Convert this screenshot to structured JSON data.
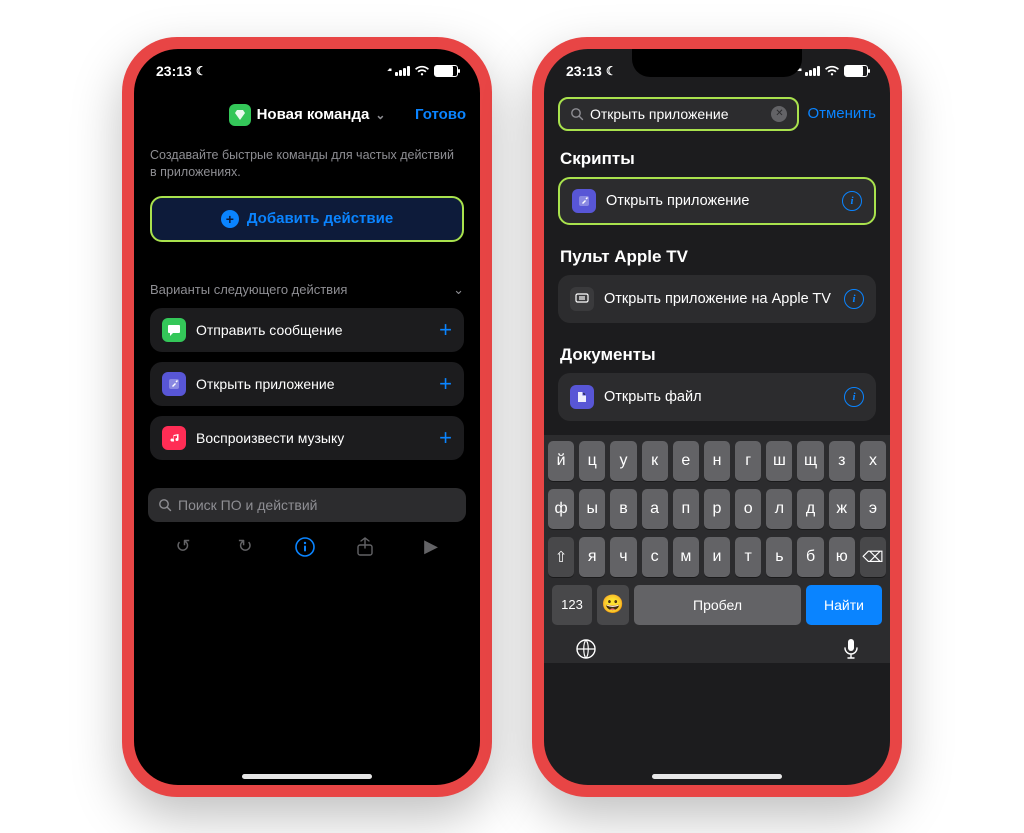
{
  "status": {
    "time": "23:13"
  },
  "phone1": {
    "nav": {
      "title": "Новая команда",
      "done": "Готово"
    },
    "hint": "Создавайте быстрые команды для частых действий в приложениях.",
    "add_action": "Добавить действие",
    "suggestions": {
      "header": "Варианты следующего действия",
      "items": [
        {
          "label": "Отправить сообщение",
          "color": "#34c759",
          "icon": "message"
        },
        {
          "label": "Открыть приложение",
          "color": "#5856d6",
          "icon": "app"
        },
        {
          "label": "Воспроизвести музыку",
          "color": "#ff2d55",
          "icon": "music"
        }
      ]
    },
    "search_placeholder": "Поиск ПО и действий"
  },
  "phone2": {
    "search": {
      "value": "Открыть приложение",
      "cancel": "Отменить"
    },
    "sections": [
      {
        "title": "Скрипты",
        "items": [
          {
            "label": "Открыть приложение",
            "color": "#5856d6",
            "icon": "app",
            "highlight": true
          }
        ]
      },
      {
        "title": "Пульт Apple TV",
        "items": [
          {
            "label": "Открыть приложение на Apple TV",
            "color": "#3a3a3c",
            "icon": "tv",
            "highlight": false
          }
        ]
      },
      {
        "title": "Документы",
        "items": [
          {
            "label": "Открыть файл",
            "color": "#5856d6",
            "icon": "file",
            "highlight": false
          }
        ]
      }
    ],
    "keyboard": {
      "row1": [
        "й",
        "ц",
        "у",
        "к",
        "е",
        "н",
        "г",
        "ш",
        "щ",
        "з",
        "х"
      ],
      "row2": [
        "ф",
        "ы",
        "в",
        "а",
        "п",
        "р",
        "о",
        "л",
        "д",
        "ж",
        "э"
      ],
      "row3": [
        "я",
        "ч",
        "с",
        "м",
        "и",
        "т",
        "ь",
        "б",
        "ю"
      ],
      "k123": "123",
      "space": "Пробел",
      "find": "Найти"
    }
  }
}
